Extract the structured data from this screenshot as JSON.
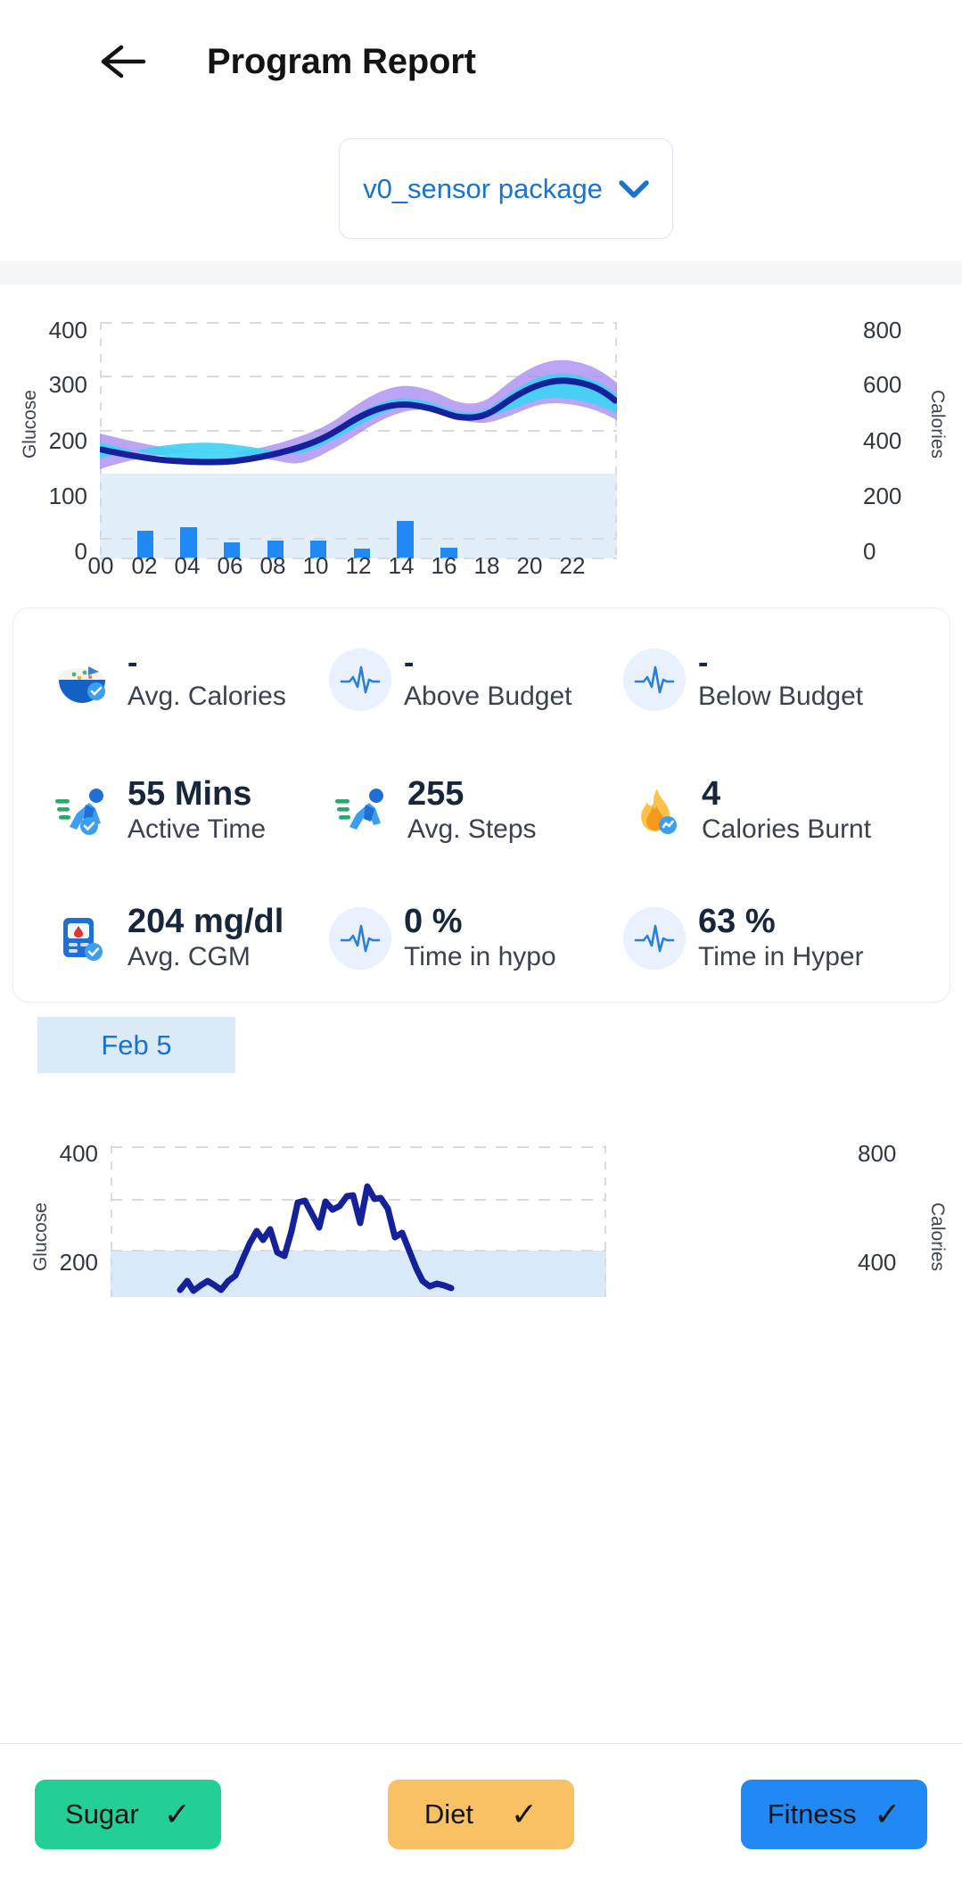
{
  "header": {
    "title": "Program Report",
    "back_icon": "arrow-left-icon"
  },
  "package_select": {
    "value": "v0_sensor package",
    "chevron_icon": "chevron-down-icon",
    "accent": "#1a73cf"
  },
  "stats": {
    "rows": [
      [
        {
          "icon": "rice-bowl-icon",
          "value": "-",
          "label": "Avg. Calories"
        },
        {
          "icon": "pulse-icon",
          "value": "-",
          "label": "Above Budget"
        },
        {
          "icon": "pulse-icon",
          "value": "-",
          "label": "Below Budget"
        }
      ],
      [
        {
          "icon": "running-person-icon",
          "value": "55 Mins",
          "label": "Active Time"
        },
        {
          "icon": "running-person-icon",
          "value": "255",
          "label": "Avg. Steps"
        },
        {
          "icon": "flame-icon",
          "value": "4",
          "label": "Calories Burnt"
        }
      ],
      [
        {
          "icon": "glucometer-icon",
          "value": "204 mg/dl",
          "label": "Avg. CGM"
        },
        {
          "icon": "pulse-icon",
          "value": "0 %",
          "label": "Time in hypo"
        },
        {
          "icon": "pulse-icon",
          "value": "63 %",
          "label": "Time in Hyper"
        }
      ]
    ]
  },
  "date_chip": {
    "label": "Feb 5"
  },
  "bottom_bar": {
    "buttons": [
      {
        "label": "Sugar",
        "color": "#23cf96",
        "check": "✓"
      },
      {
        "label": "Diet",
        "color": "#f9c163",
        "check": "✓"
      },
      {
        "label": "Fitness",
        "color": "#2089f4",
        "check": "✓"
      }
    ]
  },
  "chart_data": [
    {
      "id": "chart-glucose-calories-aggregate",
      "type": "area",
      "title": "",
      "xlabel": "",
      "ylabel": "Glucose",
      "y2label": "Calories",
      "xticks": [
        "00",
        "02",
        "04",
        "06",
        "08",
        "10",
        "12",
        "14",
        "16",
        "18",
        "20",
        "22"
      ],
      "yticks": [
        0,
        100,
        200,
        300,
        400
      ],
      "y2ticks": [
        0,
        200,
        400,
        600,
        800
      ],
      "ylim": [
        0,
        400
      ],
      "y2lim": [
        0,
        800
      ],
      "grid": "dashed-horizontal",
      "target_zone": {
        "from": 0,
        "to": 140,
        "color": "#e3eefb"
      },
      "x": [
        0,
        1,
        2,
        3,
        4,
        5,
        6,
        7,
        8,
        9,
        10,
        11,
        12,
        13,
        14,
        15,
        16,
        17,
        18,
        19,
        20,
        21,
        22,
        23
      ],
      "series": [
        {
          "name": "Glucose median",
          "color": "#15219b",
          "values": [
            163,
            158,
            152,
            147,
            143,
            140,
            138,
            137,
            140,
            160,
            190,
            212,
            216,
            207,
            200,
            203,
            228,
            243,
            245,
            245,
            247,
            243,
            224,
            200
          ]
        },
        {
          "name": "Glucose IQR upper",
          "color": "#3fd2f5",
          "values": [
            196,
            186,
            178,
            172,
            167,
            163,
            160,
            158,
            170,
            205,
            236,
            248,
            245,
            239,
            245,
            265,
            292,
            305,
            300,
            293,
            282,
            268,
            245,
            217
          ]
        },
        {
          "name": "Glucose IQR lower",
          "color": "#3fd2f5",
          "values": [
            143,
            137,
            130,
            124,
            119,
            114,
            110,
            108,
            112,
            130,
            160,
            185,
            190,
            180,
            172,
            170,
            192,
            210,
            213,
            214,
            216,
            211,
            197,
            178
          ]
        },
        {
          "name": "Glucose range upper",
          "color": "#a78bf0",
          "values": [
            211,
            200,
            192,
            186,
            180,
            176,
            172,
            170,
            184,
            226,
            262,
            280,
            273,
            266,
            275,
            300,
            327,
            337,
            331,
            322,
            309,
            292,
            266,
            233
          ]
        },
        {
          "name": "Glucose range lower",
          "color": "#a78bf0",
          "values": [
            130,
            123,
            116,
            109,
            104,
            99,
            95,
            92,
            96,
            114,
            143,
            168,
            174,
            163,
            155,
            152,
            174,
            193,
            197,
            199,
            202,
            197,
            183,
            165
          ]
        },
        {
          "name": "Calories",
          "type": "bar",
          "color": "#2089f4",
          "x": [
            2,
            4,
            6,
            8,
            10,
            12,
            14,
            16
          ],
          "values": [
            42,
            48,
            24,
            26,
            26,
            13,
            60,
            14
          ]
        }
      ]
    },
    {
      "id": "chart-glucose-calories-feb5",
      "type": "line",
      "title": "",
      "xlabel": "",
      "ylabel": "Glucose",
      "y2label": "Calories",
      "yticks": [
        200,
        400
      ],
      "y2ticks": [
        400,
        800
      ],
      "ylim": [
        0,
        400
      ],
      "y2lim": [
        0,
        800
      ],
      "grid": "dashed-horizontal",
      "target_zone": {
        "from": 0,
        "to": 160,
        "color": "#d9e9fa"
      },
      "series": [
        {
          "name": "Glucose",
          "color": "#15219b",
          "values": [
            92,
            90,
            88,
            86,
            88,
            90,
            88,
            86,
            90,
            96,
            120,
            152,
            200,
            178,
            206,
            160,
            152,
            196,
            270,
            272,
            244,
            218,
            268,
            252,
            262,
            282,
            286,
            222,
            304,
            274,
            276,
            256,
            196,
            208,
            176,
            140,
            120,
            112,
            116,
            114
          ]
        }
      ]
    }
  ]
}
